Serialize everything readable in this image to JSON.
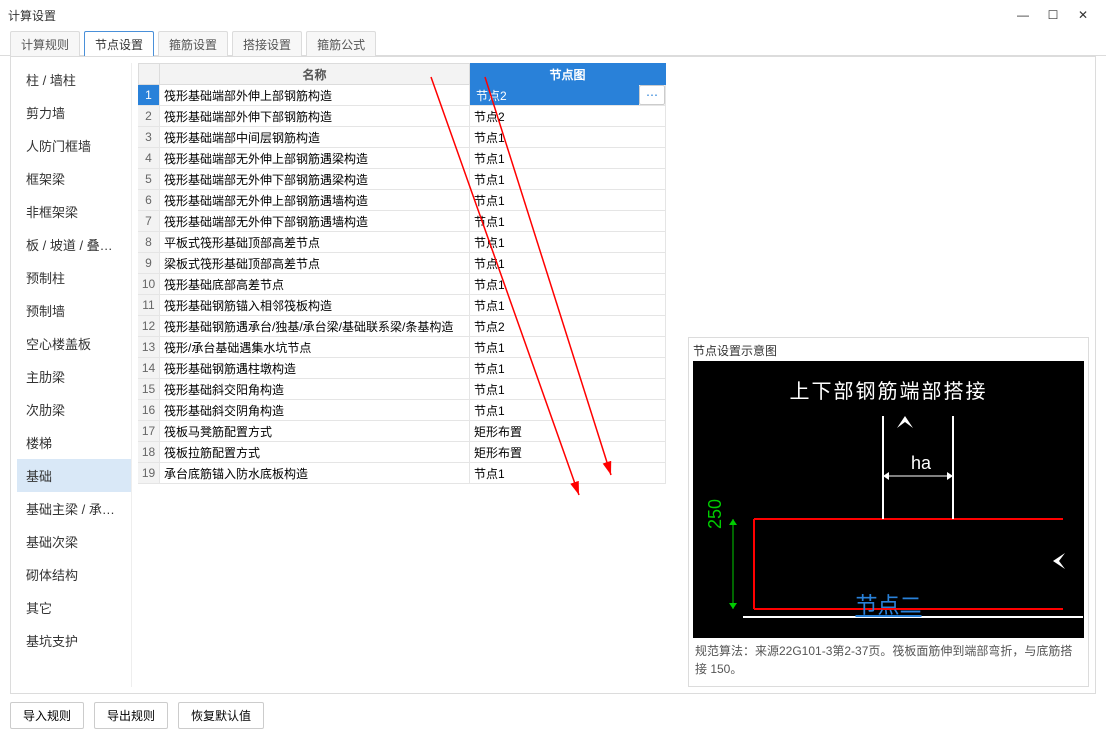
{
  "window": {
    "title": "计算设置"
  },
  "tabs": [
    "计算规则",
    "节点设置",
    "箍筋设置",
    "搭接设置",
    "箍筋公式"
  ],
  "activeTab": 1,
  "sidebar": {
    "items": [
      "柱 / 墙柱",
      "剪力墙",
      "人防门框墙",
      "框架梁",
      "非框架梁",
      "板 / 坡道 / 叠合...",
      "预制柱",
      "预制墙",
      "空心楼盖板",
      "主肋梁",
      "次肋梁",
      "楼梯",
      "基础",
      "基础主梁 / 承台梁",
      "基础次梁",
      "砌体结构",
      "其它",
      "基坑支护"
    ],
    "active": 12
  },
  "table": {
    "head": {
      "name": "名称",
      "node": "节点图"
    },
    "rows": [
      {
        "n": 1,
        "name": "筏形基础端部外伸上部钢筋构造",
        "node": "节点2",
        "sel": true
      },
      {
        "n": 2,
        "name": "筏形基础端部外伸下部钢筋构造",
        "node": "节点2"
      },
      {
        "n": 3,
        "name": "筏形基础端部中间层钢筋构造",
        "node": "节点1"
      },
      {
        "n": 4,
        "name": "筏形基础端部无外伸上部钢筋遇梁构造",
        "node": "节点1"
      },
      {
        "n": 5,
        "name": "筏形基础端部无外伸下部钢筋遇梁构造",
        "node": "节点1"
      },
      {
        "n": 6,
        "name": "筏形基础端部无外伸上部钢筋遇墙构造",
        "node": "节点1"
      },
      {
        "n": 7,
        "name": "筏形基础端部无外伸下部钢筋遇墙构造",
        "node": "节点1"
      },
      {
        "n": 8,
        "name": "平板式筏形基础顶部高差节点",
        "node": "节点1"
      },
      {
        "n": 9,
        "name": "梁板式筏形基础顶部高差节点",
        "node": "节点1"
      },
      {
        "n": 10,
        "name": "筏形基础底部高差节点",
        "node": "节点1"
      },
      {
        "n": 11,
        "name": "筏形基础钢筋锚入相邻筏板构造",
        "node": "节点1"
      },
      {
        "n": 12,
        "name": "筏形基础钢筋遇承台/独基/承台梁/基础联系梁/条基构造",
        "node": "节点2"
      },
      {
        "n": 13,
        "name": "筏形/承台基础遇集水坑节点",
        "node": "节点1"
      },
      {
        "n": 14,
        "name": "筏形基础钢筋遇柱墩构造",
        "node": "节点1"
      },
      {
        "n": 15,
        "name": "筏形基础斜交阳角构造",
        "node": "节点1"
      },
      {
        "n": 16,
        "name": "筏形基础斜交阴角构造",
        "node": "节点1"
      },
      {
        "n": 17,
        "name": "筏板马凳筋配置方式",
        "node": "矩形布置"
      },
      {
        "n": 18,
        "name": "筏板拉筋配置方式",
        "node": "矩形布置"
      },
      {
        "n": 19,
        "name": "承台底筋锚入防水底板构造",
        "node": "节点1"
      }
    ]
  },
  "preview": {
    "title": "节点设置示意图",
    "diagTitle": "上下部钢筋端部搭接",
    "ha": "ha",
    "dim": "250",
    "nodeLabel": "节点二",
    "desc": "规范算法：来源22G101-3第2-37页。筏板面筋伸到端部弯折，与底筋搭接 150。"
  },
  "buttons": {
    "import": "导入规则",
    "export": "导出规则",
    "restore": "恢复默认值"
  }
}
